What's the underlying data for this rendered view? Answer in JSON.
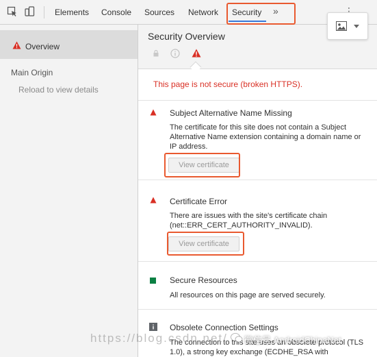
{
  "toolbar": {
    "tabs": [
      "Elements",
      "Console",
      "Sources",
      "Network",
      "Security"
    ],
    "active_tab": "Security",
    "more": "»",
    "menu": "⋮"
  },
  "sidebar": {
    "overview_label": "Overview",
    "main_origin_label": "Main Origin",
    "reload_hint": "Reload to view details"
  },
  "main": {
    "title": "Security Overview",
    "summary": "This page is not secure (broken HTTPS).",
    "sections": [
      {
        "title": "Subject Alternative Name Missing",
        "body": "The certificate for this site does not contain a Subject Alternative Name extension containing a domain name or IP address.",
        "button": "View certificate",
        "status": "insecure"
      },
      {
        "title": "Certificate Error",
        "body": "There are issues with the site's certificate chain (net::ERR_CERT_AUTHORITY_INVALID).",
        "button": "View certificate",
        "status": "insecure"
      },
      {
        "title": "Secure Resources",
        "body": "All resources on this page are served securely.",
        "status": "secure"
      },
      {
        "title": "Obsolete Connection Settings",
        "body": "The connection to this site uses an obsolete protocol (TLS 1.0), a strong key exchange (ECDHE_RSA with",
        "status": "info"
      }
    ]
  },
  "overlay": {
    "watermark": "https://blog.csdn.net/",
    "wechat": "微信号 AndroidChinaNet"
  },
  "colors": {
    "insecure": "#d93025",
    "secure": "#0b8043",
    "highlight": "#e9592f",
    "tab_underline": "#3879d9"
  }
}
